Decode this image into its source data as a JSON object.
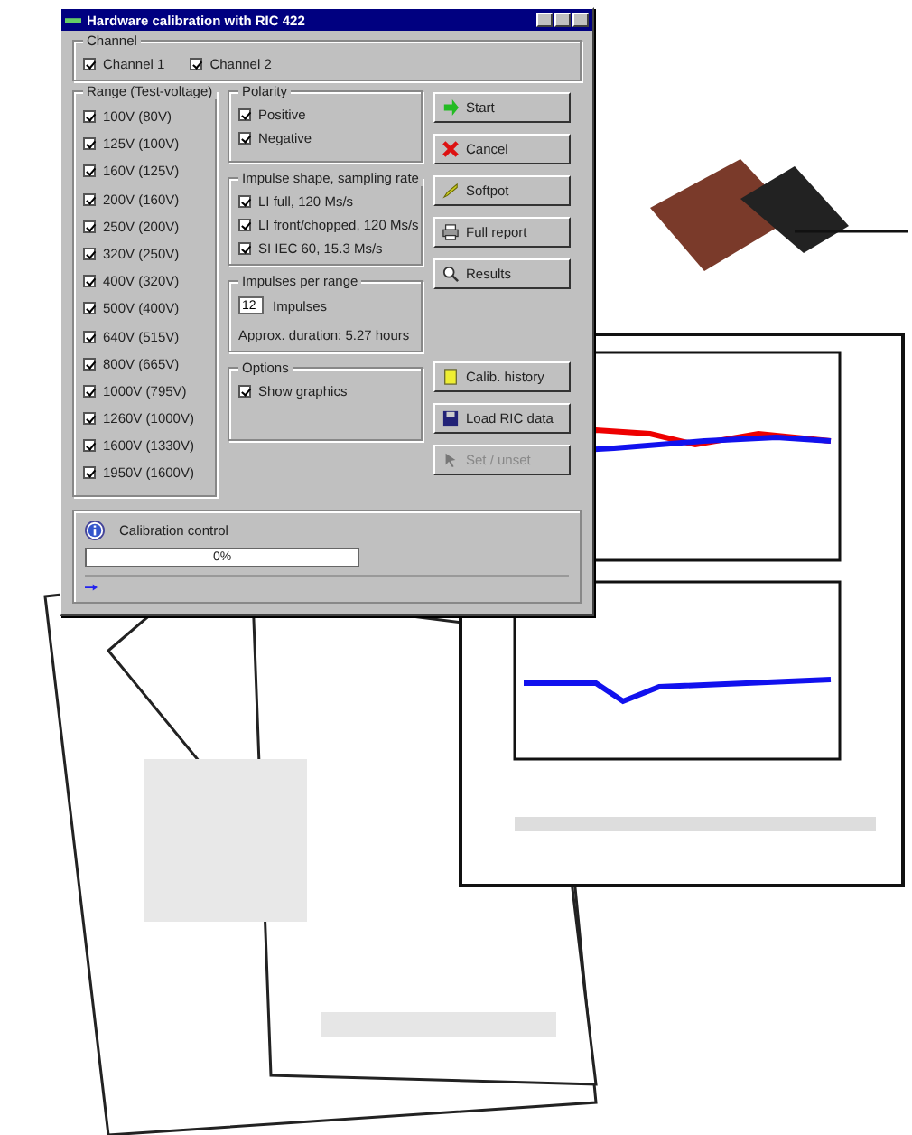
{
  "window": {
    "title": "Hardware calibration with RIC 422"
  },
  "channel": {
    "title": "Channel",
    "items": [
      {
        "label": "Channel 1",
        "checked": true
      },
      {
        "label": "Channel 2",
        "checked": true
      }
    ]
  },
  "range": {
    "title": "Range (Test-voltage)",
    "items": [
      {
        "label": "100V (80V)",
        "checked": true
      },
      {
        "label": "125V (100V)",
        "checked": true
      },
      {
        "label": "160V (125V)",
        "checked": true
      },
      {
        "label": "200V (160V)",
        "checked": true
      },
      {
        "label": "250V (200V)",
        "checked": true
      },
      {
        "label": "320V (250V)",
        "checked": true
      },
      {
        "label": "400V (320V)",
        "checked": true
      },
      {
        "label": "500V (400V)",
        "checked": true
      },
      {
        "label": "640V (515V)",
        "checked": true
      },
      {
        "label": "800V (665V)",
        "checked": true
      },
      {
        "label": "1000V (795V)",
        "checked": true
      },
      {
        "label": "1260V (1000V)",
        "checked": true
      },
      {
        "label": "1600V (1330V)",
        "checked": true
      },
      {
        "label": "1950V (1600V)",
        "checked": true
      }
    ]
  },
  "polarity": {
    "title": "Polarity",
    "items": [
      {
        "label": "Positive",
        "checked": true
      },
      {
        "label": "Negative",
        "checked": true
      }
    ]
  },
  "impulse_shape": {
    "title": "Impulse shape, sampling rate",
    "items": [
      {
        "label": "LI full, 120 Ms/s",
        "checked": true
      },
      {
        "label": "LI front/chopped, 120 Ms/s",
        "checked": true
      },
      {
        "label": "SI IEC 60, 15.3 Ms/s",
        "checked": true
      }
    ]
  },
  "impulses_per_range": {
    "title": "Impulses per range",
    "value": "12",
    "label": "Impulses",
    "duration": "Approx. duration: 5.27 hours"
  },
  "options": {
    "title": "Options",
    "items": [
      {
        "label": "Show graphics",
        "checked": true
      }
    ]
  },
  "buttons": [
    {
      "label": "Start",
      "disabled": false
    },
    {
      "label": "Cancel",
      "disabled": false
    },
    {
      "label": "Softpot",
      "disabled": false
    },
    {
      "label": "Full report",
      "disabled": false
    },
    {
      "label": "Results",
      "disabled": false
    },
    {
      "label": "Calib. history",
      "disabled": false
    },
    {
      "label": "Load RIC data",
      "disabled": false
    },
    {
      "label": "Set / unset",
      "disabled": true
    }
  ],
  "calibration": {
    "title": "Calibration control",
    "progress": {
      "level": 0,
      "reading": "0%"
    }
  }
}
